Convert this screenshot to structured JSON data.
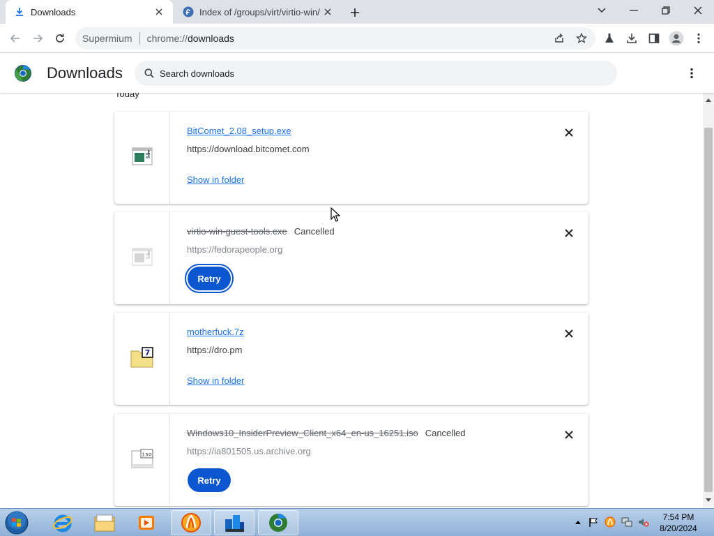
{
  "tabs": [
    {
      "title": "Downloads",
      "favicon": "download-icon",
      "active": true
    },
    {
      "title": "Index of /groups/virt/virtio-win/",
      "favicon": "fedora-icon",
      "active": false
    }
  ],
  "omnibox": {
    "site_chip": "Supermium",
    "url_scheme": "chrome://",
    "url_path": "downloads"
  },
  "page": {
    "title": "Downloads",
    "search_placeholder": "Search downloads",
    "date_label": "Today"
  },
  "downloads": [
    {
      "filename": "BitComet_2.08_setup.exe",
      "status": "",
      "source": "https://download.bitcomet.com",
      "action": "Show in folder",
      "state": "complete",
      "file_icon": "exe-file-icon"
    },
    {
      "filename": "virtio-win-guest-tools.exe",
      "status": "Cancelled",
      "source": "https://fedorapeople.org",
      "action": "Retry",
      "state": "cancelled",
      "file_icon": "exe-file-icon"
    },
    {
      "filename": "motherfuck.7z",
      "status": "",
      "source": "https://dro.pm",
      "action": "Show in folder",
      "state": "complete",
      "file_icon": "7z-archive-icon"
    },
    {
      "filename": "Windows10_InsiderPreview_Client_x64_en-us_16251.iso",
      "status": "Cancelled",
      "source": "https://ia801505.us.archive.org",
      "action": "Retry",
      "state": "cancelled",
      "file_icon": "iso-file-icon"
    }
  ],
  "taskbar": {
    "apps": [
      "internet-explorer-icon",
      "windows-explorer-icon",
      "media-player-icon",
      "bitcomet-icon",
      "file-manager-icon",
      "supermium-icon"
    ],
    "clock_time": "7:54 PM",
    "clock_date": "8/20/2024"
  },
  "colors": {
    "accent": "#1a73e8",
    "retry_button": "#0b57d0",
    "tabstrip": "#dee1e6"
  }
}
